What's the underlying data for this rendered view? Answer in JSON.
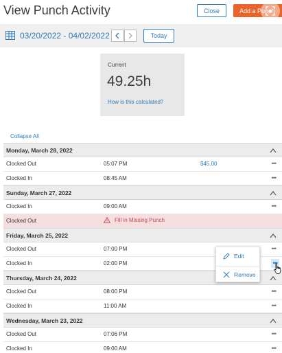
{
  "header": {
    "title": "View Punch Activity",
    "close_label": "Close",
    "add_label": "Add a Punch"
  },
  "datebar": {
    "date_range": "03/20/2022 - 04/02/2022",
    "today_label": "Today"
  },
  "summary": {
    "label": "Current",
    "value": "49.25h",
    "link": "How is this calculated?"
  },
  "collapse_all_label": "Collapse All",
  "days": [
    {
      "title": "Monday, March 28, 2022",
      "rows": [
        {
          "label": "Clocked Out",
          "time": "05:07 PM",
          "amount": "$45.00"
        },
        {
          "label": "Clocked In",
          "time": "08:45 AM"
        }
      ]
    },
    {
      "title": "Sunday, March 27, 2022",
      "rows": [
        {
          "label": "Clocked In",
          "time": "09:00 AM"
        },
        {
          "label": "Clocked Out",
          "warning": "Fill in Missing Punch"
        }
      ]
    },
    {
      "title": "Friday, March 25, 2022",
      "rows": [
        {
          "label": "Clocked Out",
          "time": "07:00 PM"
        },
        {
          "label": "Clocked In",
          "time": "02:00 PM"
        }
      ]
    },
    {
      "title": "Thursday, March 24, 2022",
      "rows": [
        {
          "label": "Clocked Out",
          "time": "08:00 PM"
        },
        {
          "label": "Clocked In",
          "time": "11:00 AM"
        }
      ]
    },
    {
      "title": "Wednesday, March 23, 2022",
      "rows": [
        {
          "label": "Clocked Out",
          "time": "07:06 PM"
        },
        {
          "label": "Clocked In",
          "time": "09:00 AM"
        }
      ]
    }
  ],
  "more_glyph": "•••",
  "popup": {
    "edit_label": "Edit",
    "remove_label": "Remove"
  },
  "colors": {
    "accent": "#2f7ab8",
    "primary_button": "#e8642b",
    "missing_row": "#f6dede",
    "warning": "#c4474a"
  }
}
